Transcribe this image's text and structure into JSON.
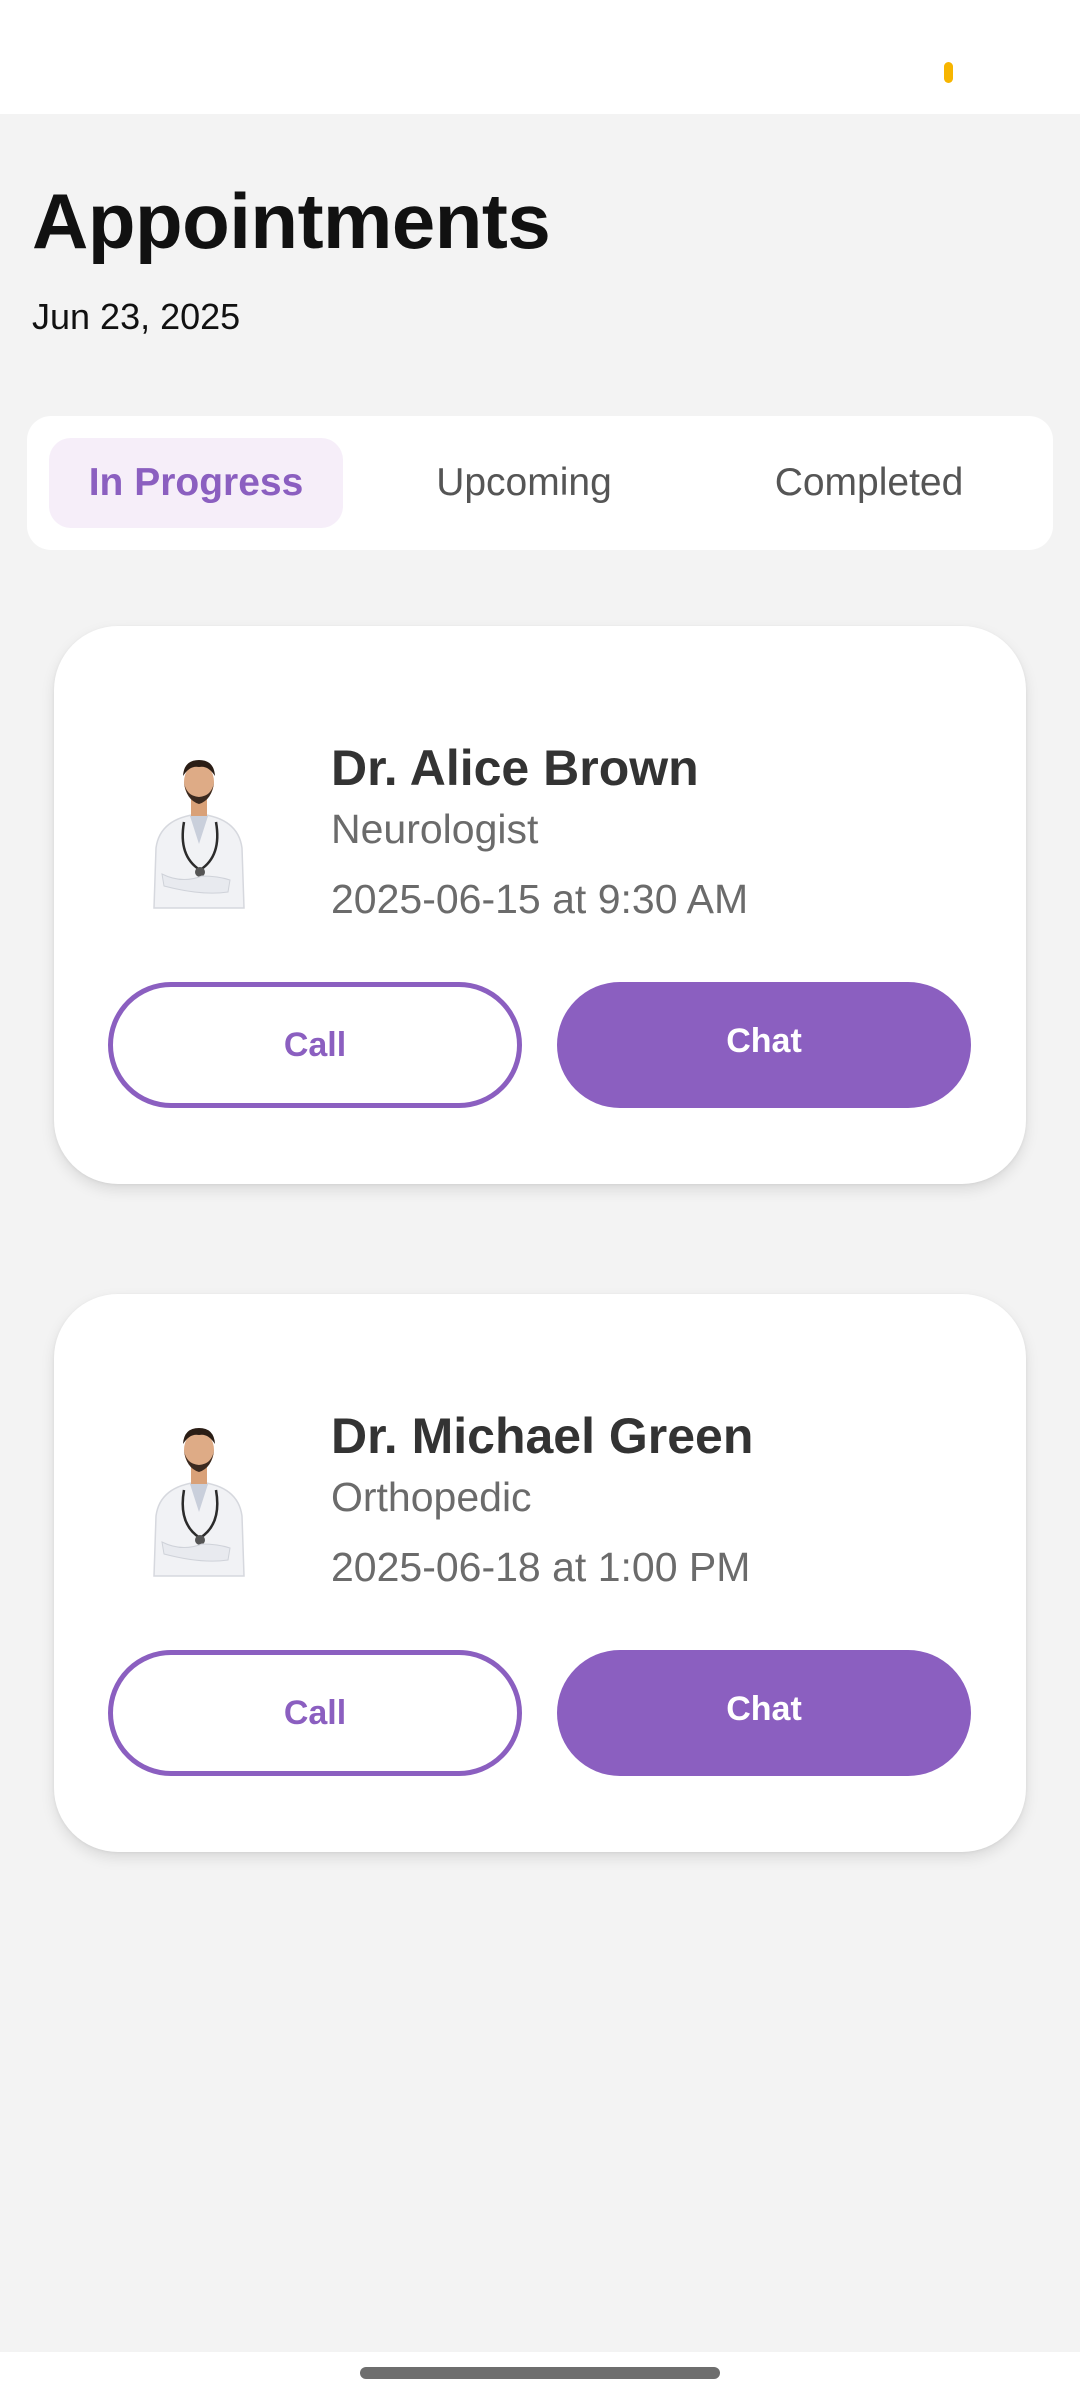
{
  "header": {
    "title": "Appointments",
    "date": "Jun 23, 2025"
  },
  "tabs": [
    {
      "label": "In Progress",
      "selected": true
    },
    {
      "label": "Upcoming",
      "selected": false
    },
    {
      "label": "Completed",
      "selected": false
    }
  ],
  "appointments": [
    {
      "doctor": "Dr. Alice Brown",
      "specialty": "Neurologist",
      "datetime": "2025-06-15 at 9:30 AM",
      "call_label": "Call",
      "chat_label": "Chat"
    },
    {
      "doctor": "Dr. Michael Green",
      "specialty": "Orthopedic",
      "datetime": "2025-06-18 at 1:00 PM",
      "call_label": "Call",
      "chat_label": "Chat"
    }
  ],
  "colors": {
    "accent": "#8b5fc0",
    "tab_active_bg": "#f6eef9",
    "background": "#f3f3f3",
    "status_indicator": "#f7b500"
  },
  "icons": [
    "doctor-avatar-icon",
    "home-indicator"
  ]
}
